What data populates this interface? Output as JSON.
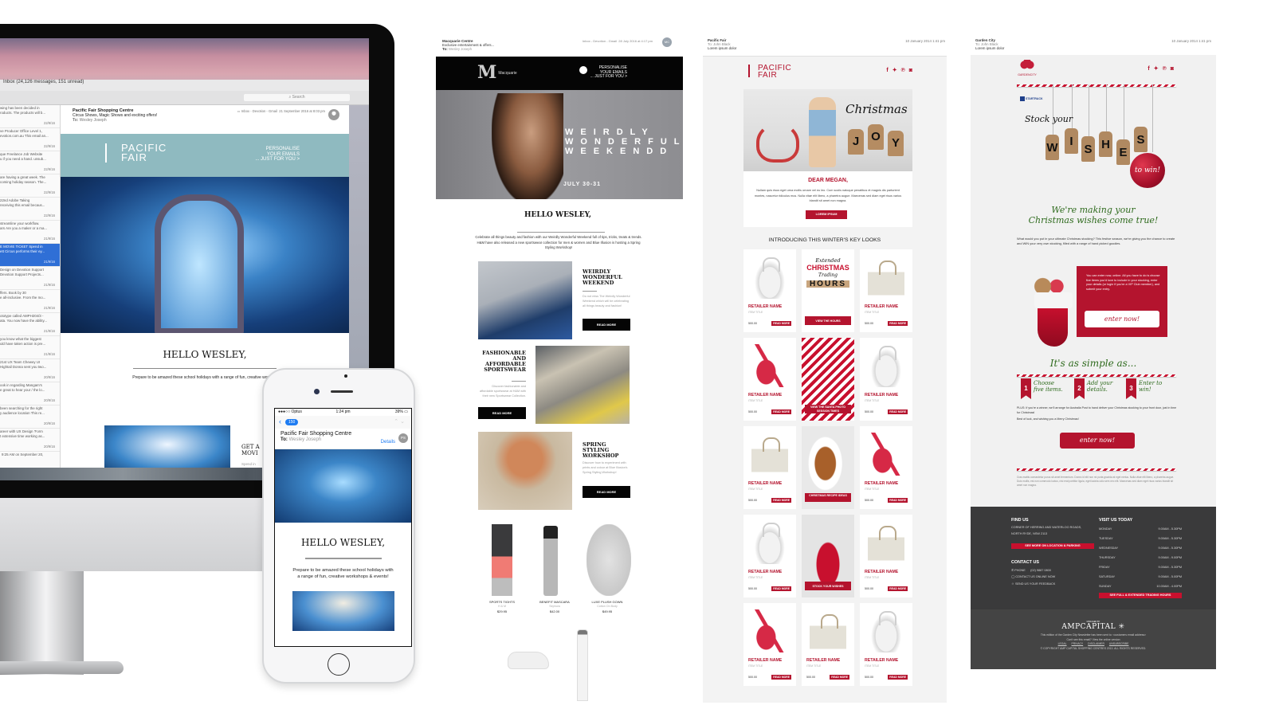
{
  "imac": {
    "mail_window_title": "Inbox (24,126 messages, 151 unread)",
    "search_placeholder": "Search",
    "message_list": [
      {
        "preview1": "wing has been decided in",
        "preview2": "roducts. The products will b...",
        "date": "22/9/16",
        "selected": false
      },
      {
        "preview1": "ve Producer Office Level 1,",
        "preview2": "evotion.com.au This email an...",
        "date": "22/9/16",
        "selected": false
      },
      {
        "preview1": "que Freelance Job Website",
        "preview2": "u if you need a hand. unsub...",
        "date": "22/9/16",
        "selected": false
      },
      {
        "preview1": "are having a great week. The",
        "preview2": "coming holiday season. The...",
        "date": "22/9/16",
        "selected": false
      },
      {
        "preview1": "22nd Adobe Taking",
        "preview2": "receiving this email becaus...",
        "date": "22/9/16",
        "selected": false
      },
      {
        "preview1": "streamline your workflow.",
        "preview2": "ars Are you a maker or a ma...",
        "date": "21/9/16",
        "selected": false
      },
      {
        "preview1": "E MOVIE TICKET Spend in",
        "preview2": "ett Circus performs their ey...",
        "date": "21/9/16",
        "selected": true
      },
      {
        "preview1": "Design on Devotion Support",
        "preview2": "Devotion Support Projects...",
        "date": "21/9/16",
        "selected": false
      },
      {
        "preview1": "ffers. Book by 30",
        "preview2": "e all-inclusive. From the mo...",
        "date": "21/9/16",
        "selected": false
      },
      {
        "preview1": "ototype called AMPH204/3 -",
        "preview2": "ata. You now have the ability...",
        "date": "21/9/16",
        "selected": false
      },
      {
        "preview1": "you know what the biggest",
        "preview2": "uld have taken action is pre...",
        "date": "21/9/16",
        "selected": false
      },
      {
        "preview1": "21st UX Team Chewey UI",
        "preview2": "Hightail Donna sent you two...",
        "date": "20/9/16",
        "selected": false
      },
      {
        "preview1": "ook in regarding Mangam's",
        "preview2": "e great to hear your / the lo...",
        "date": "20/9/16",
        "selected": false
      },
      {
        "preview1": "been searching for the right",
        "preview2": "y audience location This re...",
        "date": "20/9/16",
        "selected": false
      },
      {
        "preview1": "areer with UX Design 'Form",
        "preview2": "t extensive time working as...",
        "date": "20/9/16",
        "selected": false
      }
    ],
    "list_footer": "9:25 AM on September 20,",
    "email": {
      "from": "Pacific Fair Shopping Centre",
      "subject": "Circus Shows, Magic Shows and exciting offers!",
      "to_label": "To:",
      "to": "Wesley Joseph",
      "mailbox": "Inbox - Devotion - Gmail",
      "date": "21 September 2016 at 8:03 pm",
      "brand_line1": "PACIFIC",
      "brand_line2": "FAIR",
      "personalise": [
        "PERSONALISE",
        "YOUR EMAILS",
        "... JUST FOR YOU >"
      ],
      "greeting": "HELLO WESLEY,",
      "intro": "Prepare to be amazed these school holidays with a range of fun, creative worksho",
      "feature_title": [
        "GET A",
        "MOVI"
      ],
      "feature_desc": [
        "Spend in",
        "FREE ev"
      ]
    }
  },
  "iphone": {
    "carrier": "●●●○○ Optus",
    "time": "1:24 pm",
    "battery": "39%",
    "back_count": "150",
    "from": "Pacific Fair Shopping Centre",
    "to_label": "To:",
    "to": "Wesley Joseph",
    "details_link": "Details",
    "avatar_initials": "PS",
    "greeting": "HELLO WESLEY,",
    "intro": "Prepare to be amazed these school holidays with a range of fun, creative workshops & events!"
  },
  "macquarie": {
    "from": "Macquarie Centre",
    "subject": "Exclusive entertainment & offers...",
    "to_label": "To:",
    "to": "Wesley Joseph",
    "mailbox": "Inbox - Devotion - Gmail",
    "date": "28 July 2016 at 4:17 pm",
    "avatar_initials": "MC",
    "logo_letter": "M",
    "logo_name": "Macquarie",
    "logo_sub": "CENTRE",
    "personalise": [
      "PERSONALISE",
      "YOUR EMAILS",
      "... JUST FOR YOU >"
    ],
    "hero_lines": [
      "WEIRDLY",
      "WONDERFULY",
      "WEEKENDD"
    ],
    "hero_date": "JULY 30-31",
    "greeting": "HELLO WESLEY,",
    "intro": "Celebrate all things beauty and fashion with our Weirdly Wonderful Weekend full of tips, tricks, treats & trends. H&M have also released a new sportswear collection for men & women and Blue Illusion is hosting a Spring Styling Workshop!",
    "features": [
      {
        "title": "WEIRDLY WONDERFUL WEEKEND",
        "desc": "Do not miss The Weirdly Wonderful Weekend which will be celebrating all things beauty and fashion!",
        "button": "READ MORE"
      },
      {
        "title": "FASHIONABLE AND AFFORDABLE SPORTSWEAR",
        "desc": "Discover fashionable and affordable sportswear at H&M with their new Sportswear Collection.",
        "button": "READ MORE"
      },
      {
        "title": "SPRING STYLING WORKSHOP",
        "desc": "Discover how to experiment with prints and colour at Blue Illusion's Spring Styling Workshop!",
        "button": "READ MORE"
      }
    ],
    "products": [
      {
        "name": "SPORTS TIGHTS",
        "brand": "H & M",
        "price": "$29.95"
      },
      {
        "name": "BENEFIT MASCARA",
        "brand": "Sephora",
        "price": "$42.00"
      },
      {
        "name": "LUXE PLUSH GOWN",
        "brand": "Cotton On Body",
        "price": "$49.95"
      }
    ]
  },
  "pacific_fair_xmas": {
    "from": "Pacific Fair",
    "to_label": "To:",
    "to": "John Black",
    "subject": "Lorem ipsum dolor",
    "date": "10 January 2014 1:41 pm",
    "brand_line1": "PACIFIC",
    "brand_line2": "FAIR",
    "social_icons": [
      "facebook-icon",
      "twitter-icon",
      "pinterest-icon",
      "instagram-icon"
    ],
    "hero_script": "Christmas",
    "hero_tags": [
      "J",
      "O",
      "Y"
    ],
    "greeting": "DEAR MEGAN,",
    "body": "Nullam quis risus eget urna mollis ornare vel eu leo. Cum sociis natoque penatibus et magnis dis parturient montes, nascetur ridiculus mus. Nulla vitae elit libero, a pharetra augue. Maecenas sed diam eget risus varius blandit sit amet non magna.",
    "cta": "LOREM IPSUM",
    "section_title": "INTRODUCING THIS WINTER'S KEY LOOKS",
    "tile_retailer": "RETAILER NAME",
    "tile_item": "ITEM TITLE",
    "tile_price": "500.00",
    "tile_button": "READ MORE",
    "grid": [
      [
        "bag-white",
        "promo-hours",
        "bag-cream"
      ],
      [
        "heel",
        "promo-santa",
        "bag-white"
      ],
      [
        "bag-cream",
        "promo-turkey",
        "heel"
      ],
      [
        "bag-white",
        "promo-stock",
        "bag-cream"
      ],
      [
        "heel",
        "bag-cream",
        "bag-white"
      ]
    ],
    "promos": {
      "promo-hours": {
        "button": "VIEW THE HOURS",
        "art": [
          "Extended",
          "CHRISTMAS",
          "Trading",
          "HOURS"
        ]
      },
      "promo-santa": {
        "button": "VIEW THE SANTA PHOTO SESSION TIMES"
      },
      "promo-turkey": {
        "button": "CHRISTMAS RECIPE IDEAS"
      },
      "promo-stock": {
        "button": "STOCK YOUR WISHES"
      }
    }
  },
  "garden_city": {
    "from": "Garden City",
    "to_label": "To:",
    "to": "John Black",
    "subject": "Lorem ipsum dolor",
    "date": "10 January 2014 1:41 pm",
    "logo_text": "GARDENCITY",
    "sponsor": "STARTRACK",
    "social_icons": [
      "facebook-icon",
      "twitter-icon",
      "pinterest-icon",
      "instagram-icon"
    ],
    "stock_your": "Stock your",
    "wishes_tags": [
      "W",
      "I",
      "S",
      "H",
      "E",
      "S"
    ],
    "to_win": "to win!",
    "headline": [
      "We're making your",
      "Christmas wishes come true!"
    ],
    "intro": "What would you put in your ultimate Christmas stocking? This festive season, we're giving you the chance to create and WIN your very own stocking, filled with a range of hand picked goodies.",
    "red_box": "You can enter now, online. All you have to do is choose five items you'd love to include in your stocking, enter your details (or login if you're a VIP Club member), and submit your entry.",
    "enter_now": "enter now!",
    "simple_title": "It's as simple as...",
    "steps": [
      {
        "num": "1",
        "label": "Choose five items."
      },
      {
        "num": "2",
        "label": "Add your details."
      },
      {
        "num": "3",
        "label": "Enter to win!"
      }
    ],
    "plus": "PLUS: If you're a winner, we'll arrange for Australia Post to hand deliver your Christmas stocking to your front door, just in time for Christmas!",
    "best": "Best of luck, and wishing you a Merry Christmas!",
    "fine_print": "Cras mattis consectetur purus sit amet fermentum. Donec id elit non mi porta gravida at eget metus. Nulla vitae elit libero, a pharetra augue. Duis mollis, est non commodo luctus, nisi erat porttitor ligula, eget lacinia odio sem nec elit. Maecenas sed diam eget risus varius blandit sit amet non magna.",
    "footer": {
      "find_us": "FIND US",
      "address": [
        "CORNER OF HERRING AND WATERLOO ROADS,",
        "NORTH RYDE, NSW 2113"
      ],
      "location_btn": "SEE MORE ON LOCATION & PARKING",
      "contact_us": "CONTACT US",
      "phone_label": "PHONE",
      "phone": "(02) 9887 0800",
      "contact_online": "CONTACT US ONLINE NOW",
      "feedback": "SEND US YOUR FEEDBACK",
      "visit_us": "VISIT US TODAY",
      "hours": [
        {
          "day": "MONDAY",
          "time": "9.00AM - 5.30PM"
        },
        {
          "day": "TUESDAY",
          "time": "9.00AM - 5.30PM"
        },
        {
          "day": "WEDNESDAY",
          "time": "9.00AM - 5.30PM"
        },
        {
          "day": "THURSDAY",
          "time": "9.00AM - 9.00PM"
        },
        {
          "day": "FRIDAY",
          "time": "9.00AM - 5.30PM"
        },
        {
          "day": "SATURDAY",
          "time": "9.00AM - 5.00PM"
        },
        {
          "day": "SUNDAY",
          "time": "10.00AM - 4.00PM"
        }
      ],
      "hours_btn": "SEE FULL & EXTENDED TRADING HOURS",
      "managed_by": "MANAGED BY",
      "amp": "AMPCAPITAL",
      "notice": "This edition of the Garden City Newsletter has been sent to: <customers email address>",
      "cant_see": "Can't see this email? View the online version",
      "links": [
        "LEGAL",
        "PRIVACY",
        "DISCLAIMER",
        "UNSUBSCRIBE"
      ],
      "copyright": "© COPYRIGHT AMP CAPITAL SHOPPING CENTRES 2013. ALL RIGHTS RESERVED."
    }
  }
}
